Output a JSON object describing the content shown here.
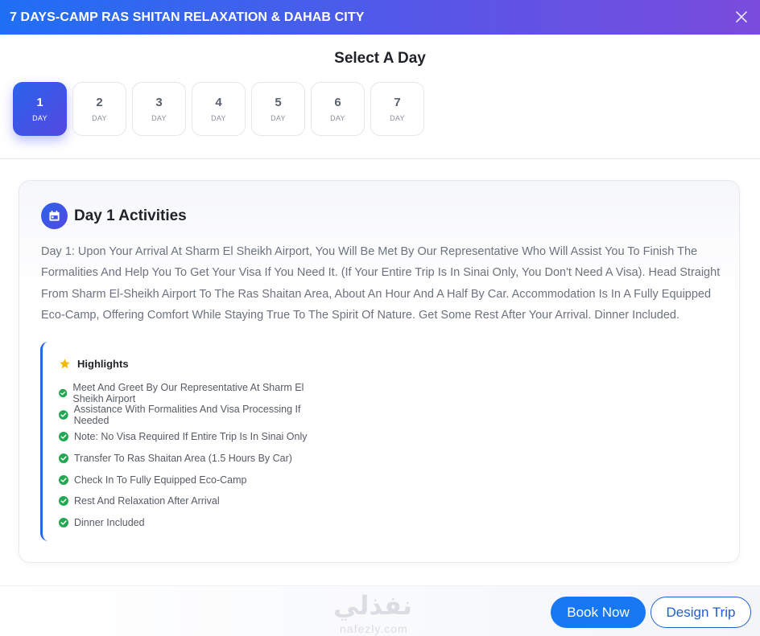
{
  "header": {
    "title": "7 DAYS-CAMP RAS SHITAN RELAXATION & DAHAB CITY"
  },
  "select_title": "Select A Day",
  "days": [
    {
      "num": "1",
      "label": "DAY"
    },
    {
      "num": "2",
      "label": "DAY"
    },
    {
      "num": "3",
      "label": "DAY"
    },
    {
      "num": "4",
      "label": "DAY"
    },
    {
      "num": "5",
      "label": "DAY"
    },
    {
      "num": "6",
      "label": "DAY"
    },
    {
      "num": "7",
      "label": "DAY"
    }
  ],
  "active_day": 1,
  "activity": {
    "title": "Day 1 Activities",
    "description": "Day 1: Upon Your Arrival At Sharm El Sheikh Airport, You Will Be Met By Our Representative Who Will Assist You To Finish The Formalities And Help You To Get Your Visa If You Need It. (If Your Entire Trip Is In Sinai Only, You Don't Need A Visa). Head Straight From Sharm El-Sheikh Airport To The Ras Shaitan Area, About An Hour And A Half By Car. Accommodation Is In A Fully Equipped Eco-Camp, Offering Comfort While Staying True To The Spirit Of Nature. Get Some Rest After Your Arrival. Dinner Included."
  },
  "highlights": {
    "title": "Highlights",
    "items": [
      "Meet And Greet By Our Representative At Sharm El Sheikh Airport",
      "Assistance With Formalities And Visa Processing If Needed",
      "Note: No Visa Required If Entire Trip Is In Sinai Only",
      "Transfer To Ras Shaitan Area (1.5 Hours By Car)",
      "Check In To Fully Equipped Eco-Camp",
      "Rest And Relaxation After Arrival",
      "Dinner Included"
    ]
  },
  "watermark": {
    "arabic": "نفذلي",
    "latin": "nafezly.com"
  },
  "footer": {
    "book_label": "Book Now",
    "design_label": "Design Trip"
  },
  "colors": {
    "accent": "#1877f2",
    "gradient_start": "#2a63ec",
    "gradient_end": "#5448df",
    "check": "#22a851",
    "star": "#f5b800"
  },
  "icons": {
    "close": "close-icon",
    "calendar": "calendar-icon",
    "star": "star-icon",
    "check": "check-circle-icon"
  }
}
